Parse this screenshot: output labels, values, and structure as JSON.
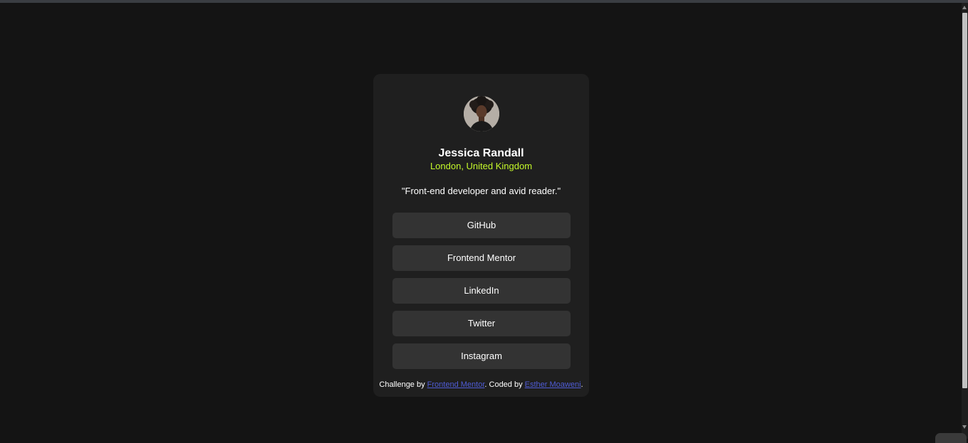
{
  "colors": {
    "background": "#141414",
    "card": "#1f1f1f",
    "button": "#333333",
    "accent": "#c4f82a",
    "link": "#4f5cd6",
    "text": "#ffffff"
  },
  "profile": {
    "avatar_icon": "profile-photo",
    "name": "Jessica Randall",
    "location": "London, United Kingdom",
    "bio": "\"Front-end developer and avid reader.\""
  },
  "links": [
    {
      "label": "GitHub"
    },
    {
      "label": "Frontend Mentor"
    },
    {
      "label": "LinkedIn"
    },
    {
      "label": "Twitter"
    },
    {
      "label": "Instagram"
    }
  ],
  "attribution": {
    "prefix": "Challenge by ",
    "challenge_link": "Frontend Mentor",
    "middle": ". Coded by ",
    "author_link": "Esther Moaweni",
    "suffix": "."
  }
}
